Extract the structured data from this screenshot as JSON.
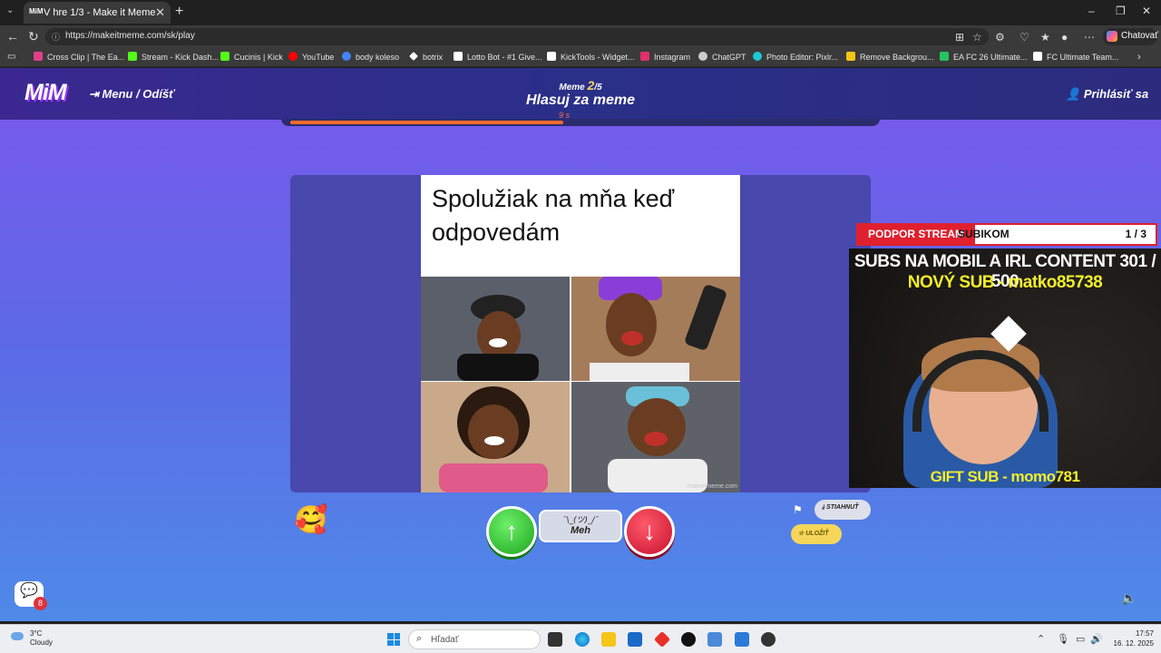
{
  "browser": {
    "tab_title": "V hre 1/3 - Make it Meme",
    "tab_favicon_text": "MiM",
    "url": "https://makeitmeme.com/sk/play",
    "copilot_label": "Chatovať",
    "favorites": [
      {
        "label": "Cross Clip | The Ea...",
        "color": "#e0408a"
      },
      {
        "label": "Stream - Kick Dash...",
        "color": "#53fc18"
      },
      {
        "label": "Cucinis | Kick",
        "color": "#53fc18"
      },
      {
        "label": "YouTube",
        "color": "#ff0000"
      },
      {
        "label": "body koleso",
        "color": "#4285f4"
      },
      {
        "label": "botrix",
        "color": "#ffffff"
      },
      {
        "label": "Lotto Bot - #1 Give...",
        "color": "#ffffff"
      },
      {
        "label": "KickTools - Widget...",
        "color": "#ffffff"
      },
      {
        "label": "Instagram",
        "color": "#e1306c"
      },
      {
        "label": "ChatGPT",
        "color": "#cccccc"
      },
      {
        "label": "Photo Editor: Pixlr...",
        "color": "#1ec8d8"
      },
      {
        "label": "Remove Backgrou...",
        "color": "#f5c518"
      },
      {
        "label": "EA FC 26 Ultimate...",
        "color": "#22c55e"
      },
      {
        "label": "FC Ultimate Team...",
        "color": "#ffffff"
      }
    ]
  },
  "header": {
    "logo": "MiM",
    "menu_label": "Menu / Odíšť",
    "round_prefix": "Meme",
    "round_current": "2",
    "round_total": "/5",
    "phase_title": "Hlasuj za meme",
    "timer": "9 s",
    "progress_fraction": 0.47,
    "login_label": "Prihlásiť sa"
  },
  "meme": {
    "caption": "Spolužiak na mňa keď odpovedám",
    "watermark": "makeitmeme.com"
  },
  "vote": {
    "up_icon": "arrow-up-icon",
    "meh_face": "¯\\_(ツ)_/¯",
    "meh_label": "Meh",
    "down_icon": "arrow-down-icon"
  },
  "actions": {
    "download_label": "STIAHNUŤ",
    "save_label": "ULOŽIŤ",
    "chat_badge": "8"
  },
  "stream_overlay": {
    "podpor_red": "PODPOR STREAM",
    "podpor_black": "SUBIKOM",
    "page": "1 / 3",
    "subs_line": "SUBS NA MOBIL A IRL CONTENT  301 / 500",
    "new_sub": "NOVÝ SUB - matko85738",
    "gift_sub": "GIFT SUB - momo781"
  },
  "taskbar": {
    "temp": "3°C",
    "weather": "Cloudy",
    "search_placeholder": "Hľadať",
    "time": "17:57",
    "date": "16. 12. 2025"
  },
  "colors": {
    "accent_orange": "#ff6a2a",
    "vote_up": "#1ca51c",
    "vote_down": "#c8102e",
    "sub_yellow": "#f2ee2a"
  }
}
